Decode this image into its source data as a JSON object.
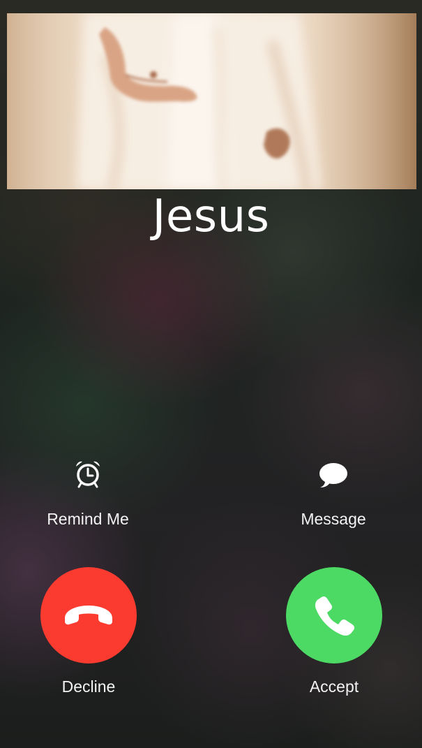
{
  "caller": {
    "name": "Jesus"
  },
  "photo": {
    "icon": "caller-photo"
  },
  "actions": {
    "remind": {
      "label": "Remind Me",
      "icon": "alarm-clock-icon"
    },
    "message": {
      "label": "Message",
      "icon": "speech-bubble-icon"
    }
  },
  "buttons": {
    "decline": {
      "label": "Decline",
      "icon": "phone-hangup-icon",
      "color": "#fc3b30"
    },
    "accept": {
      "label": "Accept",
      "icon": "phone-icon",
      "color": "#4cd964"
    }
  }
}
